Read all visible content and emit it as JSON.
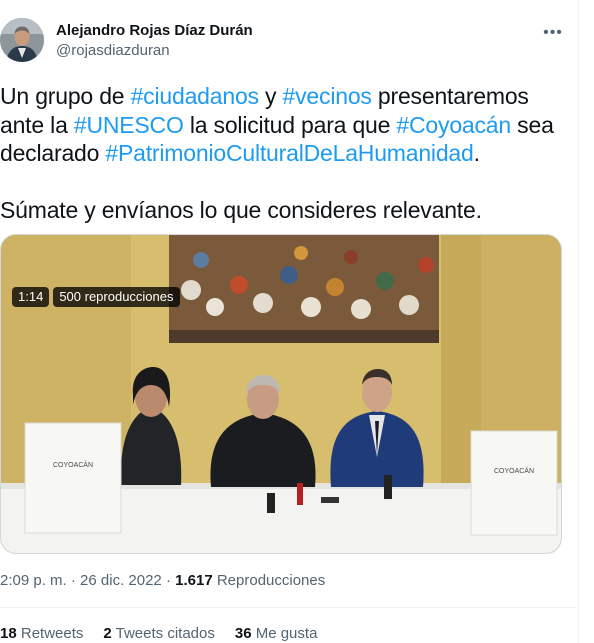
{
  "author": {
    "name": "Alejandro Rojas Díaz Durán",
    "handle": "@rojasdiazduran"
  },
  "more_icon": "more-horizontal-icon",
  "tweet": {
    "segments": [
      {
        "text": "Un grupo de ",
        "tag": false
      },
      {
        "text": "#ciudadanos",
        "tag": true
      },
      {
        "text": " y ",
        "tag": false
      },
      {
        "text": "#vecinos",
        "tag": true
      },
      {
        "text": " presentaremos\nante la ",
        "tag": false
      },
      {
        "text": "#UNESCO",
        "tag": true
      },
      {
        "text": " la solicitud para que ",
        "tag": false
      },
      {
        "text": "#Coyoacán",
        "tag": true
      },
      {
        "text": " sea\ndeclarado ",
        "tag": false
      },
      {
        "text": "#PatrimonioCulturalDeLaHumanidad",
        "tag": true
      },
      {
        "text": ".\n\nSúmate y envíanos lo que consideres relevante.",
        "tag": false
      }
    ]
  },
  "video": {
    "duration": "1:14",
    "views_badge": "500 reproducciones",
    "book_left_title": "COYOACÁN",
    "book_right_title": "COYOACÁN"
  },
  "meta": {
    "time": "2:09 p. m.",
    "separator": " · ",
    "date": "26 dic. 2022",
    "views_count": "1.617",
    "views_label": " Reproducciones"
  },
  "stats": {
    "retweets_count": "18",
    "retweets_label": " Retweets",
    "quotes_count": "2",
    "quotes_label": " Tweets citados",
    "likes_count": "36",
    "likes_label": " Me gusta"
  },
  "colors": {
    "link": "#1d9bf0",
    "text": "#0f1419",
    "secondary": "#536471"
  }
}
